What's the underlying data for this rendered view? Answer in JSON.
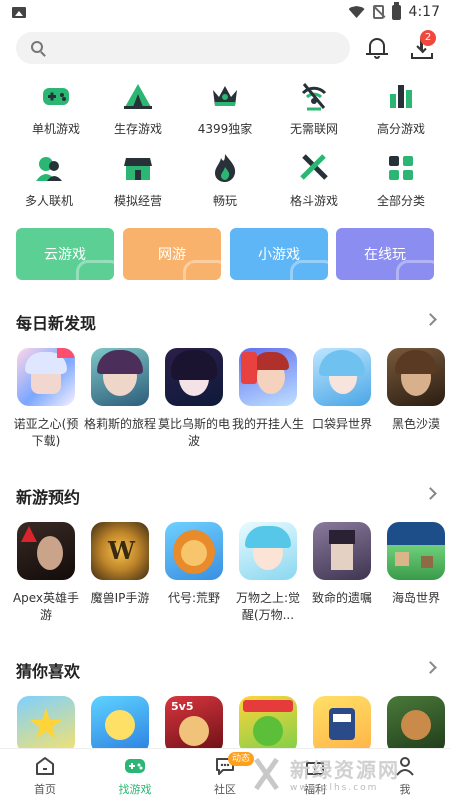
{
  "status_bar": {
    "time": "4:17"
  },
  "header": {
    "download_badge": "2"
  },
  "categories": [
    {
      "label": "单机游戏",
      "icon": "gamepad-icon",
      "color": "#2bb673"
    },
    {
      "label": "生存游戏",
      "icon": "tent-icon",
      "color": "#2bb673"
    },
    {
      "label": "4399独家",
      "icon": "crown-icon",
      "color": "#2bb673"
    },
    {
      "label": "无需联网",
      "icon": "no-network-icon",
      "color": "#2bb673"
    },
    {
      "label": "高分游戏",
      "icon": "bar-chart-icon",
      "color": "#2bb673"
    },
    {
      "label": "多人联机",
      "icon": "multiplayer-icon",
      "color": "#2bb673"
    },
    {
      "label": "模拟经营",
      "icon": "shop-icon",
      "color": "#2bb673"
    },
    {
      "label": "畅玩",
      "icon": "flame-icon",
      "color": "#2bb673"
    },
    {
      "label": "格斗游戏",
      "icon": "sword-icon",
      "color": "#2bb673"
    },
    {
      "label": "全部分类",
      "icon": "all-categories-icon",
      "color": "#2bb673"
    }
  ],
  "tiles": [
    {
      "label": "云游戏",
      "color": "#5ccf95"
    },
    {
      "label": "网游",
      "color": "#f9b26c"
    },
    {
      "label": "小游戏",
      "color": "#5fb6f6"
    },
    {
      "label": "在线玩",
      "color": "#8b8df0"
    }
  ],
  "sections": [
    {
      "title": "每日新发现",
      "games": [
        {
          "name": "诺亚之心(预下载)",
          "art": "anime-girl-icon"
        },
        {
          "name": "格莉斯的旅程",
          "art": "anime-girl-icon"
        },
        {
          "name": "莫比乌斯的电波",
          "art": "anime-girl-icon"
        },
        {
          "name": "我的开挂人生",
          "art": "anime-boy-icon"
        },
        {
          "name": "口袋异世界",
          "art": "anime-girl-icon"
        },
        {
          "name": "黑色沙漠",
          "art": "warrior-icon"
        }
      ]
    },
    {
      "title": "新游预约",
      "games": [
        {
          "name": "Apex英雄手游",
          "art": "apex-logo-icon"
        },
        {
          "name": "魔兽IP手游",
          "art": "warcraft-logo-icon"
        },
        {
          "name": "代号:荒野",
          "art": "lion-icon"
        },
        {
          "name": "万物之上:觉醒(万物...",
          "art": "anime-girl-icon"
        },
        {
          "name": "致命的遗嘱",
          "art": "character-icon"
        },
        {
          "name": "海岛世界",
          "art": "island-icon"
        }
      ]
    },
    {
      "title": "猜你喜欢",
      "games": [
        {
          "name": "",
          "art": "cartoon-star-icon"
        },
        {
          "name": "",
          "art": "magic-icon"
        },
        {
          "name": "",
          "art": "moba-icon"
        },
        {
          "name": "",
          "art": "cartoon-icon"
        },
        {
          "name": "",
          "art": "robot-icon"
        },
        {
          "name": "",
          "art": "fantasy-icon"
        }
      ]
    }
  ],
  "bottom_nav": [
    {
      "label": "首页",
      "icon": "home-icon",
      "active": false
    },
    {
      "label": "找游戏",
      "icon": "gamepad-icon",
      "active": true
    },
    {
      "label": "社区",
      "icon": "chat-icon",
      "active": false
    },
    {
      "label": "福利",
      "icon": "gift-icon",
      "active": false
    },
    {
      "label": "我",
      "icon": "user-icon",
      "active": false
    }
  ],
  "community_badge": "动态",
  "watermark": {
    "title": "新绿资源网",
    "url": "www.xlhs.com"
  },
  "colors": {
    "accent": "#2bb673",
    "badge_red": "#f0483e",
    "badge_orange": "#ff9f1c"
  }
}
